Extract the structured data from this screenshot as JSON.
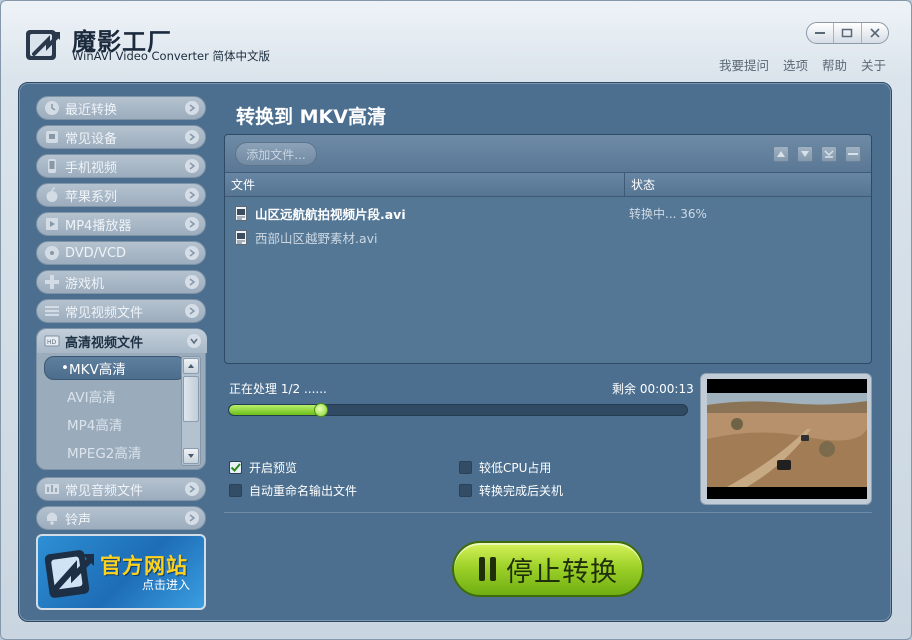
{
  "header": {
    "title": "魔影工厂",
    "subtitle": "WinAVI Video Converter 简体中文版",
    "links": [
      "我要提问",
      "选项",
      "帮助",
      "关于"
    ]
  },
  "sidebar": {
    "items": [
      {
        "label": "最近转换",
        "icon": "history-icon"
      },
      {
        "label": "常见设备",
        "icon": "device-icon"
      },
      {
        "label": "手机视频",
        "icon": "phone-icon"
      },
      {
        "label": "苹果系列",
        "icon": "apple-icon"
      },
      {
        "label": "MP4播放器",
        "icon": "mp4-player-icon"
      },
      {
        "label": "DVD/VCD",
        "icon": "disc-icon"
      },
      {
        "label": "游戏机",
        "icon": "gamepad-icon"
      },
      {
        "label": "常见视频文件",
        "icon": "video-file-icon"
      }
    ],
    "group": {
      "label": "高清视频文件",
      "icon": "hd-icon",
      "subitems": [
        "MKV高清",
        "AVI高清",
        "MP4高清",
        "MPEG2高清"
      ],
      "active_index": 0
    },
    "items_after": [
      {
        "label": "常见音频文件",
        "icon": "audio-icon"
      },
      {
        "label": "铃声",
        "icon": "ringtone-icon"
      }
    ],
    "banner": {
      "title": "官方网站",
      "subtitle": "点击进入"
    }
  },
  "content": {
    "title": "转换到 MKV高清",
    "add_button": "添加文件...",
    "columns": [
      "文件",
      "状态"
    ],
    "files": [
      {
        "name": "山区远航航拍视频片段.avi",
        "state": "转换中... 36%",
        "active": true
      },
      {
        "name": "西部山区越野素材.avi",
        "state": "",
        "active": false
      }
    ],
    "processing": "正在处理 1/2 ......",
    "remaining": "剩余 00:00:13",
    "progress": 0.2,
    "options": [
      {
        "label": "开启预览",
        "checked": true
      },
      {
        "label": "较低CPU占用",
        "checked": false
      },
      {
        "label": "自动重命名输出文件",
        "checked": false
      },
      {
        "label": "转换完成后关机",
        "checked": false
      }
    ],
    "stop_button": "停止转换"
  },
  "colors": {
    "panel": "#4c6f90",
    "accent_green": "#9fd22a",
    "progress_fill": "#6bbf1a"
  }
}
